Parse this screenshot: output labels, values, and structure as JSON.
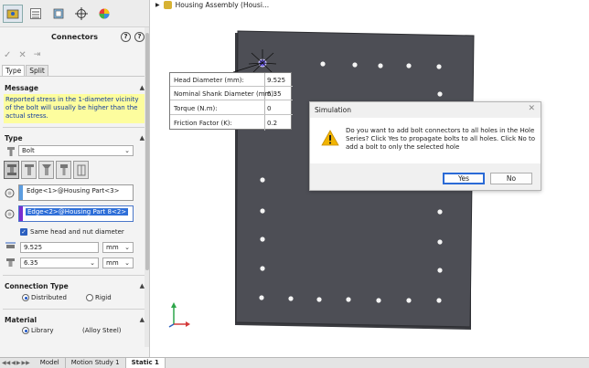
{
  "pm": {
    "title": "Connectors",
    "tab_labels": [
      "Type",
      "Split"
    ],
    "message_header": "Message",
    "message_text": "Reported stress in the 1-diameter vicinity of the bolt will usually be higher than the actual stress.",
    "type_header": "Type",
    "type_value": "Bolt",
    "edge1": "Edge<1>@Housing Part<3>",
    "edge2": "Edge<2>@Housing Part 8<2>",
    "same_head_nut_label": "Same head and nut diameter",
    "head_dia_value": "9.525",
    "head_dia_unit": "mm",
    "shank_dia_value": "6.35",
    "shank_dia_unit": "mm",
    "conn_type_header": "Connection Type",
    "distributed_label": "Distributed",
    "rigid_label": "Rigid",
    "material_header": "Material",
    "library_label": "Library",
    "material_value": "(Alloy Steel)"
  },
  "tree": {
    "assembly_label": "Housing Assembly (Housi..."
  },
  "callout": {
    "rows": [
      {
        "label": "Head Diameter (mm):",
        "value": "9.525"
      },
      {
        "label": "Nominal Shank Diameter (mm):",
        "value": "6.35"
      },
      {
        "label": "Torque (N.m):",
        "value": "0"
      },
      {
        "label": "Friction Factor (K):",
        "value": "0.2"
      }
    ]
  },
  "dialog": {
    "title": "Simulation",
    "message": "Do you want to add bolt connectors to all holes in the Hole Series? Click Yes to propagate bolts to all holes. Click No to add a bolt to only the selected hole",
    "yes_label": "Yes",
    "no_label": "No"
  },
  "bottom_tabs": [
    "Model",
    "Motion Study 1",
    "Static 1"
  ],
  "colors": {
    "plate": "#4d4e55",
    "message_bg": "#fdfd9e",
    "message_text": "#123b9e",
    "accent": "#2b5fbf",
    "edge2_stripe": "#7a2fd0"
  }
}
